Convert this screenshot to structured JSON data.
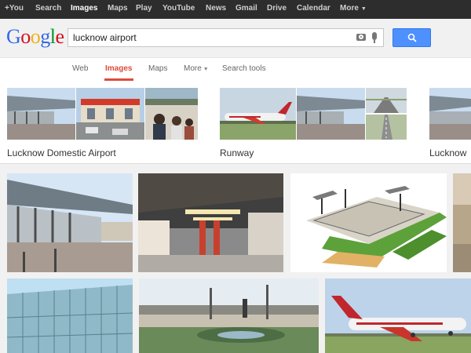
{
  "gbar": {
    "items": [
      {
        "label": "+You"
      },
      {
        "label": "Search"
      },
      {
        "label": "Images"
      },
      {
        "label": "Maps"
      },
      {
        "label": "Play"
      },
      {
        "label": "YouTube"
      },
      {
        "label": "News"
      },
      {
        "label": "Gmail"
      },
      {
        "label": "Drive"
      },
      {
        "label": "Calendar"
      },
      {
        "label": "More"
      }
    ],
    "active": "Images"
  },
  "logo": {
    "letters": [
      "G",
      "o",
      "o",
      "g",
      "l",
      "e"
    ]
  },
  "search": {
    "query": "lucknow airport",
    "button_icon": "search-icon"
  },
  "tabs": {
    "items": [
      {
        "label": "Web"
      },
      {
        "label": "Images"
      },
      {
        "label": "Maps"
      },
      {
        "label": "More"
      },
      {
        "label": "Search tools"
      }
    ],
    "active": "Images"
  },
  "related": {
    "groups": [
      {
        "label": "Lucknow Domestic Airport"
      },
      {
        "label": "Runway"
      },
      {
        "label": "Lucknow"
      }
    ]
  },
  "colors": {
    "accent_red": "#dd4b39",
    "button_blue": "#4d90fe",
    "bar_dark": "#2d2d2d"
  }
}
